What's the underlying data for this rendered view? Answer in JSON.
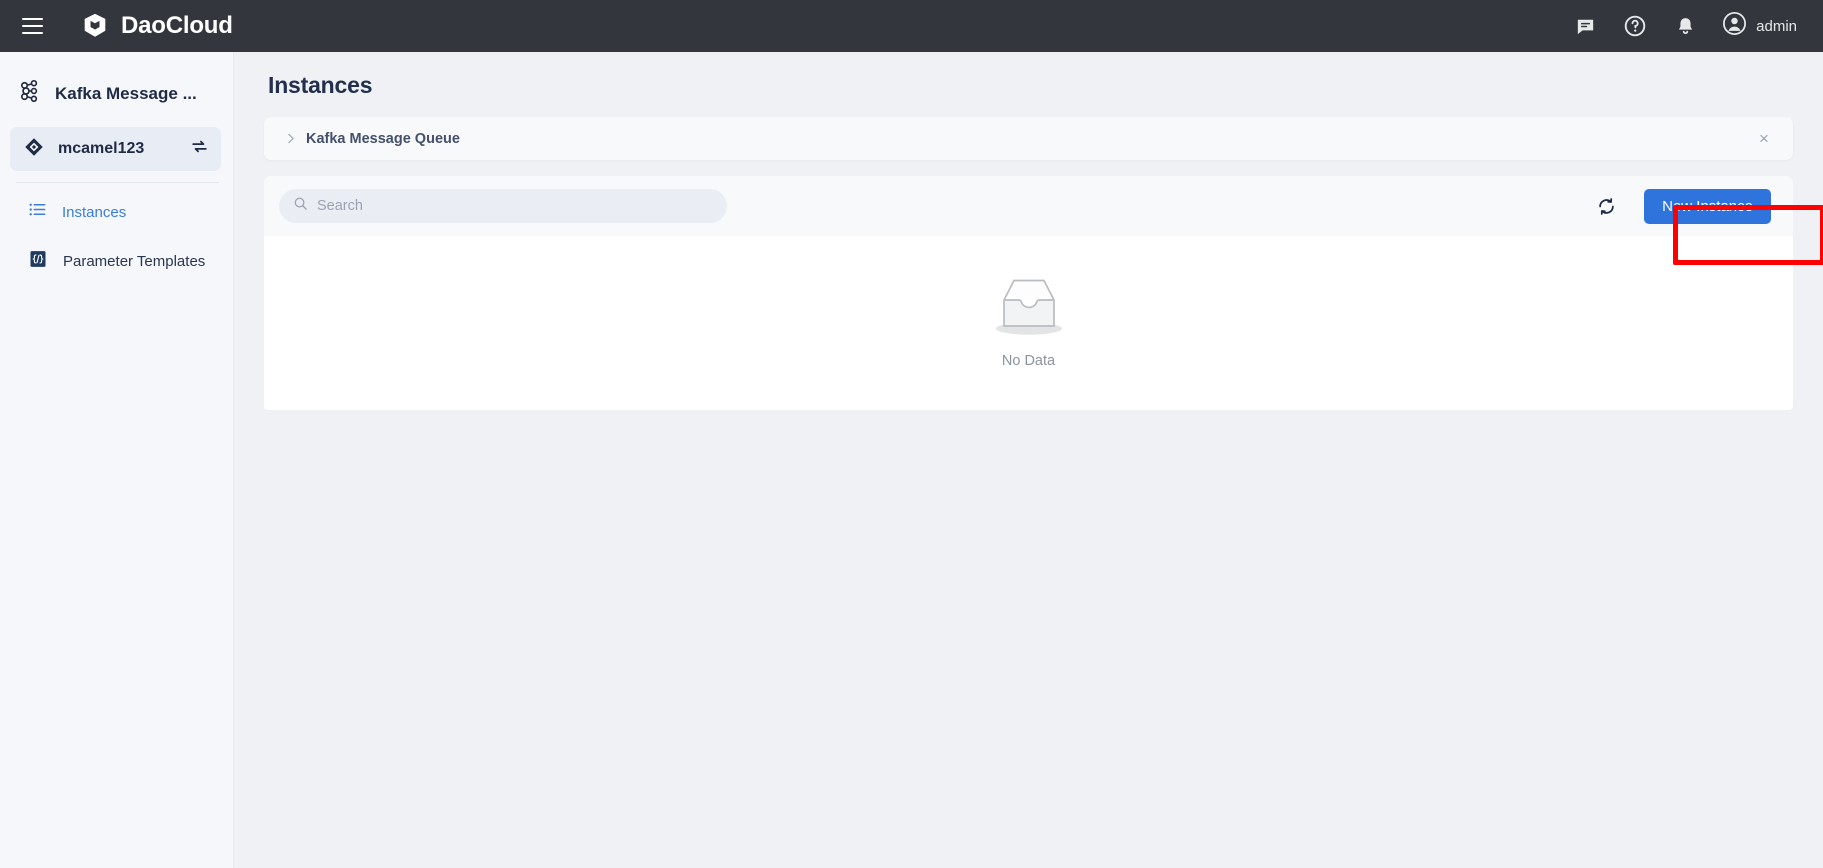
{
  "header": {
    "menu_icon": "hamburger-menu-icon",
    "brand": "DaoCloud",
    "brand_logo_icon": "daocloud-cube-logo",
    "icons": [
      {
        "name": "chat-icon",
        "label": "Chat"
      },
      {
        "name": "help-icon",
        "label": "Help"
      },
      {
        "name": "notifications-bell-icon",
        "label": "Notifications"
      }
    ],
    "user": "admin",
    "avatar_icon": "user-avatar-icon"
  },
  "sidebar": {
    "product": {
      "title": "Kafka Message ...",
      "icon": "kafka-logo-icon"
    },
    "instance": {
      "name": "mcamel123",
      "icon": "instance-diamond-icon",
      "switch_icon": "switch-instance-icon"
    },
    "nav": [
      {
        "label": "Instances",
        "icon": "list-icon",
        "active": true
      },
      {
        "label": "Parameter Templates",
        "icon": "code-braces-icon",
        "active": false
      }
    ]
  },
  "main": {
    "page_title": "Instances",
    "breadcrumb": {
      "chevron_icon": "chevron-right-icon",
      "label": "Kafka Message Queue",
      "close_icon": "close-icon",
      "close_glyph": "×"
    },
    "toolbar": {
      "search_placeholder": "Search",
      "search_value": "",
      "search_icon": "search-icon",
      "refresh_icon": "refresh-icon",
      "new_instance_label": "New Instance"
    },
    "empty_state": {
      "icon": "empty-inbox-icon",
      "label": "No Data"
    }
  },
  "annotation": {
    "highlight_target": "new-instance-button",
    "color": "#ff0000"
  },
  "colors": {
    "header_bg": "#33373d",
    "sidebar_bg": "#f5f7fb",
    "main_bg": "#eff1f5",
    "accent_blue": "#2f74dd",
    "active_link": "#3b7ddd",
    "card_bg": "#f8f9fb",
    "panel_white": "#ffffff",
    "highlight_red": "#ff0000"
  }
}
